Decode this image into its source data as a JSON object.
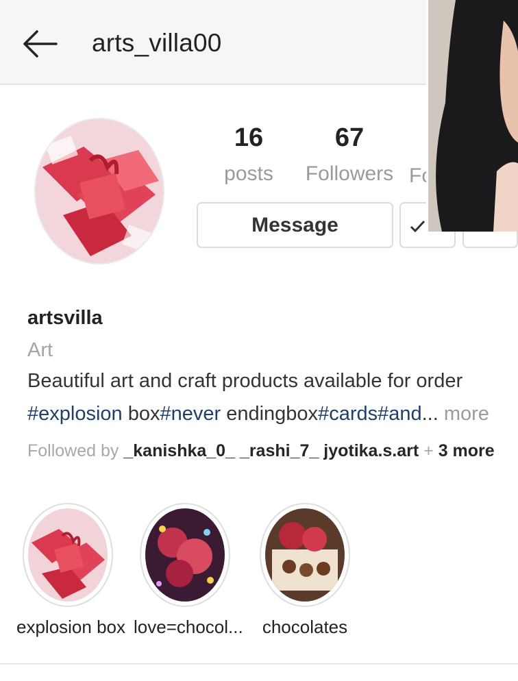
{
  "header": {
    "username": "arts_villa00",
    "back_icon": "arrow-left-icon"
  },
  "stats": {
    "posts": {
      "count": "16",
      "label": "posts"
    },
    "followers": {
      "count": "67",
      "label": "Followers"
    },
    "following_label_partial": "Fo"
  },
  "actions": {
    "message_label": "Message",
    "follow_check_icon": "check-icon"
  },
  "bio": {
    "display_name": "artsvilla",
    "category": "Art",
    "description": "Beautiful art and craft products available for order",
    "tags_line": {
      "tag1": "#explosion",
      "text1": " box",
      "tag2": "#never",
      "text2": " endingbox",
      "tag3": "#cards#and",
      "ellipsis": "...",
      "more": " more"
    },
    "followed_by": {
      "prefix": "Followed by ",
      "users": "_kanishka_0_ _rashi_7_ jyotika.s.art",
      "plus": " + ",
      "more": "3 more"
    }
  },
  "highlights": [
    {
      "label": "explosion box"
    },
    {
      "label": "love=chocol..."
    },
    {
      "label": "chocolates"
    }
  ],
  "colors": {
    "hashtag": "#1f3f6b",
    "muted": "#9b9b9b",
    "topbar": "#f6f6f6"
  }
}
